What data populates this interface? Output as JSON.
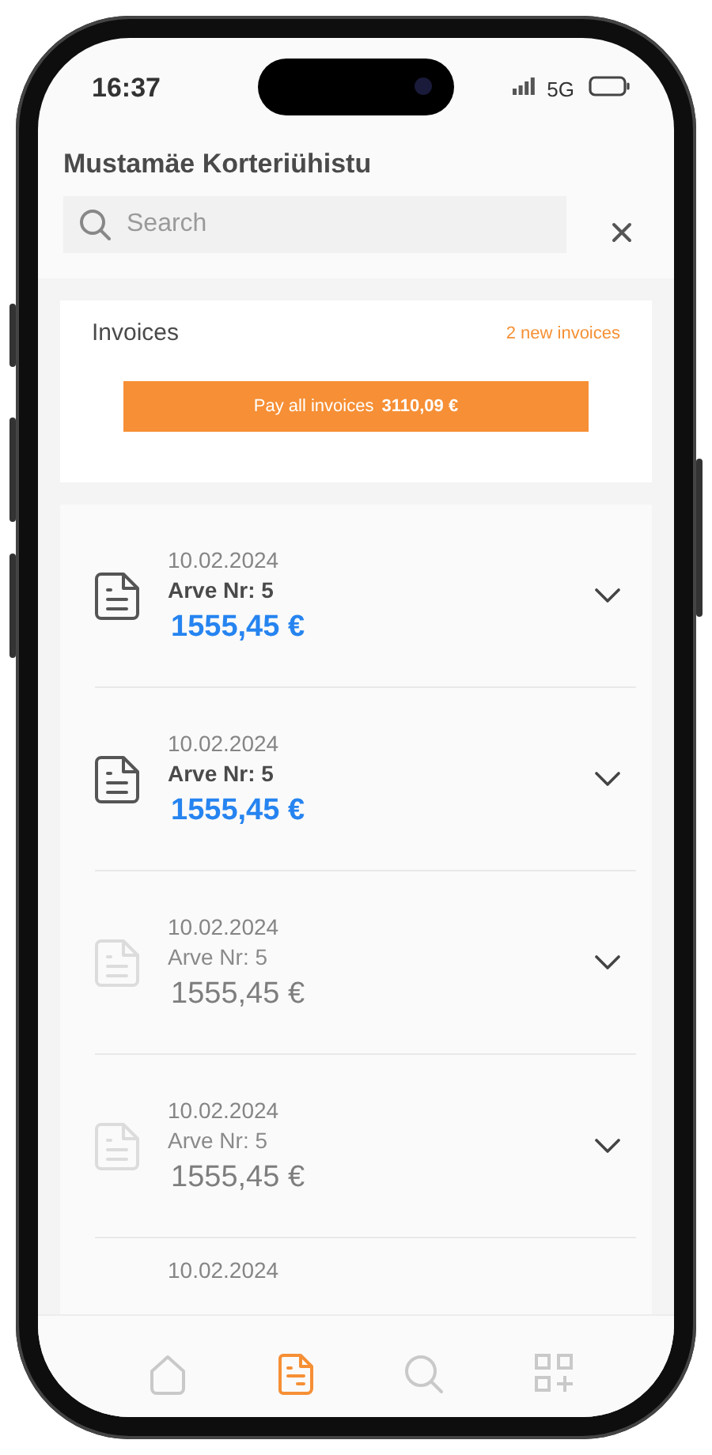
{
  "status_bar": {
    "time": "16:37",
    "network": "5G"
  },
  "header": {
    "title": "Mustamäe Korteriühistu",
    "search": {
      "placeholder": "Search"
    }
  },
  "invoices_card": {
    "title": "Invoices",
    "new_count": "2 new invoices",
    "pay_button": {
      "label": "Pay all invoices",
      "amount": "3110,09 €"
    }
  },
  "invoices": [
    {
      "date": "10.02.2024",
      "number": "Arve Nr: 5",
      "amount": "1555,45 €",
      "unread": true
    },
    {
      "date": "10.02.2024",
      "number": "Arve Nr: 5",
      "amount": "1555,45 €",
      "unread": true
    },
    {
      "date": "10.02.2024",
      "number": "Arve Nr: 5",
      "amount": "1555,45 €",
      "unread": false
    },
    {
      "date": "10.02.2024",
      "number": "Arve Nr: 5",
      "amount": "1555,45 €",
      "unread": false
    },
    {
      "date": "10.02.2024"
    }
  ],
  "tab_bar": [
    {
      "kind": "home",
      "selected": false
    },
    {
      "kind": "invoices",
      "selected": true
    },
    {
      "kind": "search",
      "selected": false
    },
    {
      "kind": "apps",
      "selected": false
    }
  ]
}
